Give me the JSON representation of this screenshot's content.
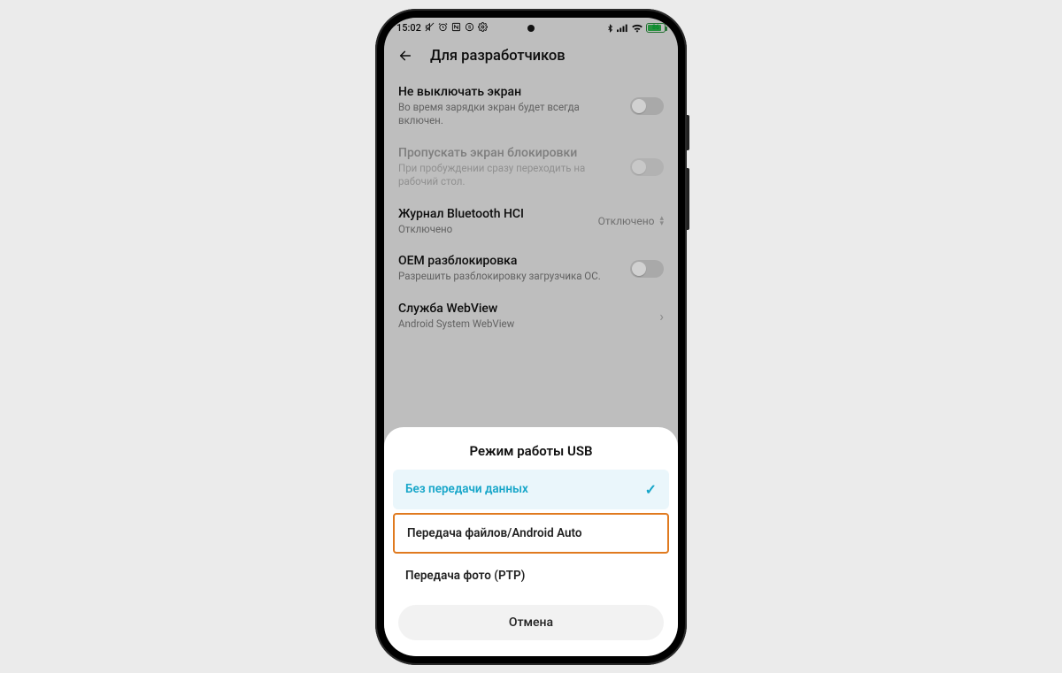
{
  "status": {
    "time": "15:02",
    "battery_pct": "86"
  },
  "header": {
    "title": "Для разработчиков"
  },
  "rows": {
    "stay_awake": {
      "title": "Не выключать экран",
      "sub": "Во время зарядки экран будет всегда включен."
    },
    "skip_lock": {
      "title": "Пропускать экран блокировки",
      "sub": "При пробуждении сразу переходить на рабочий стол."
    },
    "bt_hci": {
      "title": "Журнал Bluetooth HCI",
      "sub": "Отключено",
      "value": "Отключено"
    },
    "oem_unlock": {
      "title": "OEM разблокировка",
      "sub": "Разрешить разблокировку загрузчика ОС."
    },
    "webview": {
      "title": "Служба WebView",
      "sub": "Android System WebView"
    }
  },
  "sheet": {
    "title": "Режим работы USB",
    "opt_none": "Без передачи данных",
    "opt_file": "Передача файлов/Android Auto",
    "opt_ptp": "Передача фото (PTP)",
    "cancel": "Отмена"
  }
}
